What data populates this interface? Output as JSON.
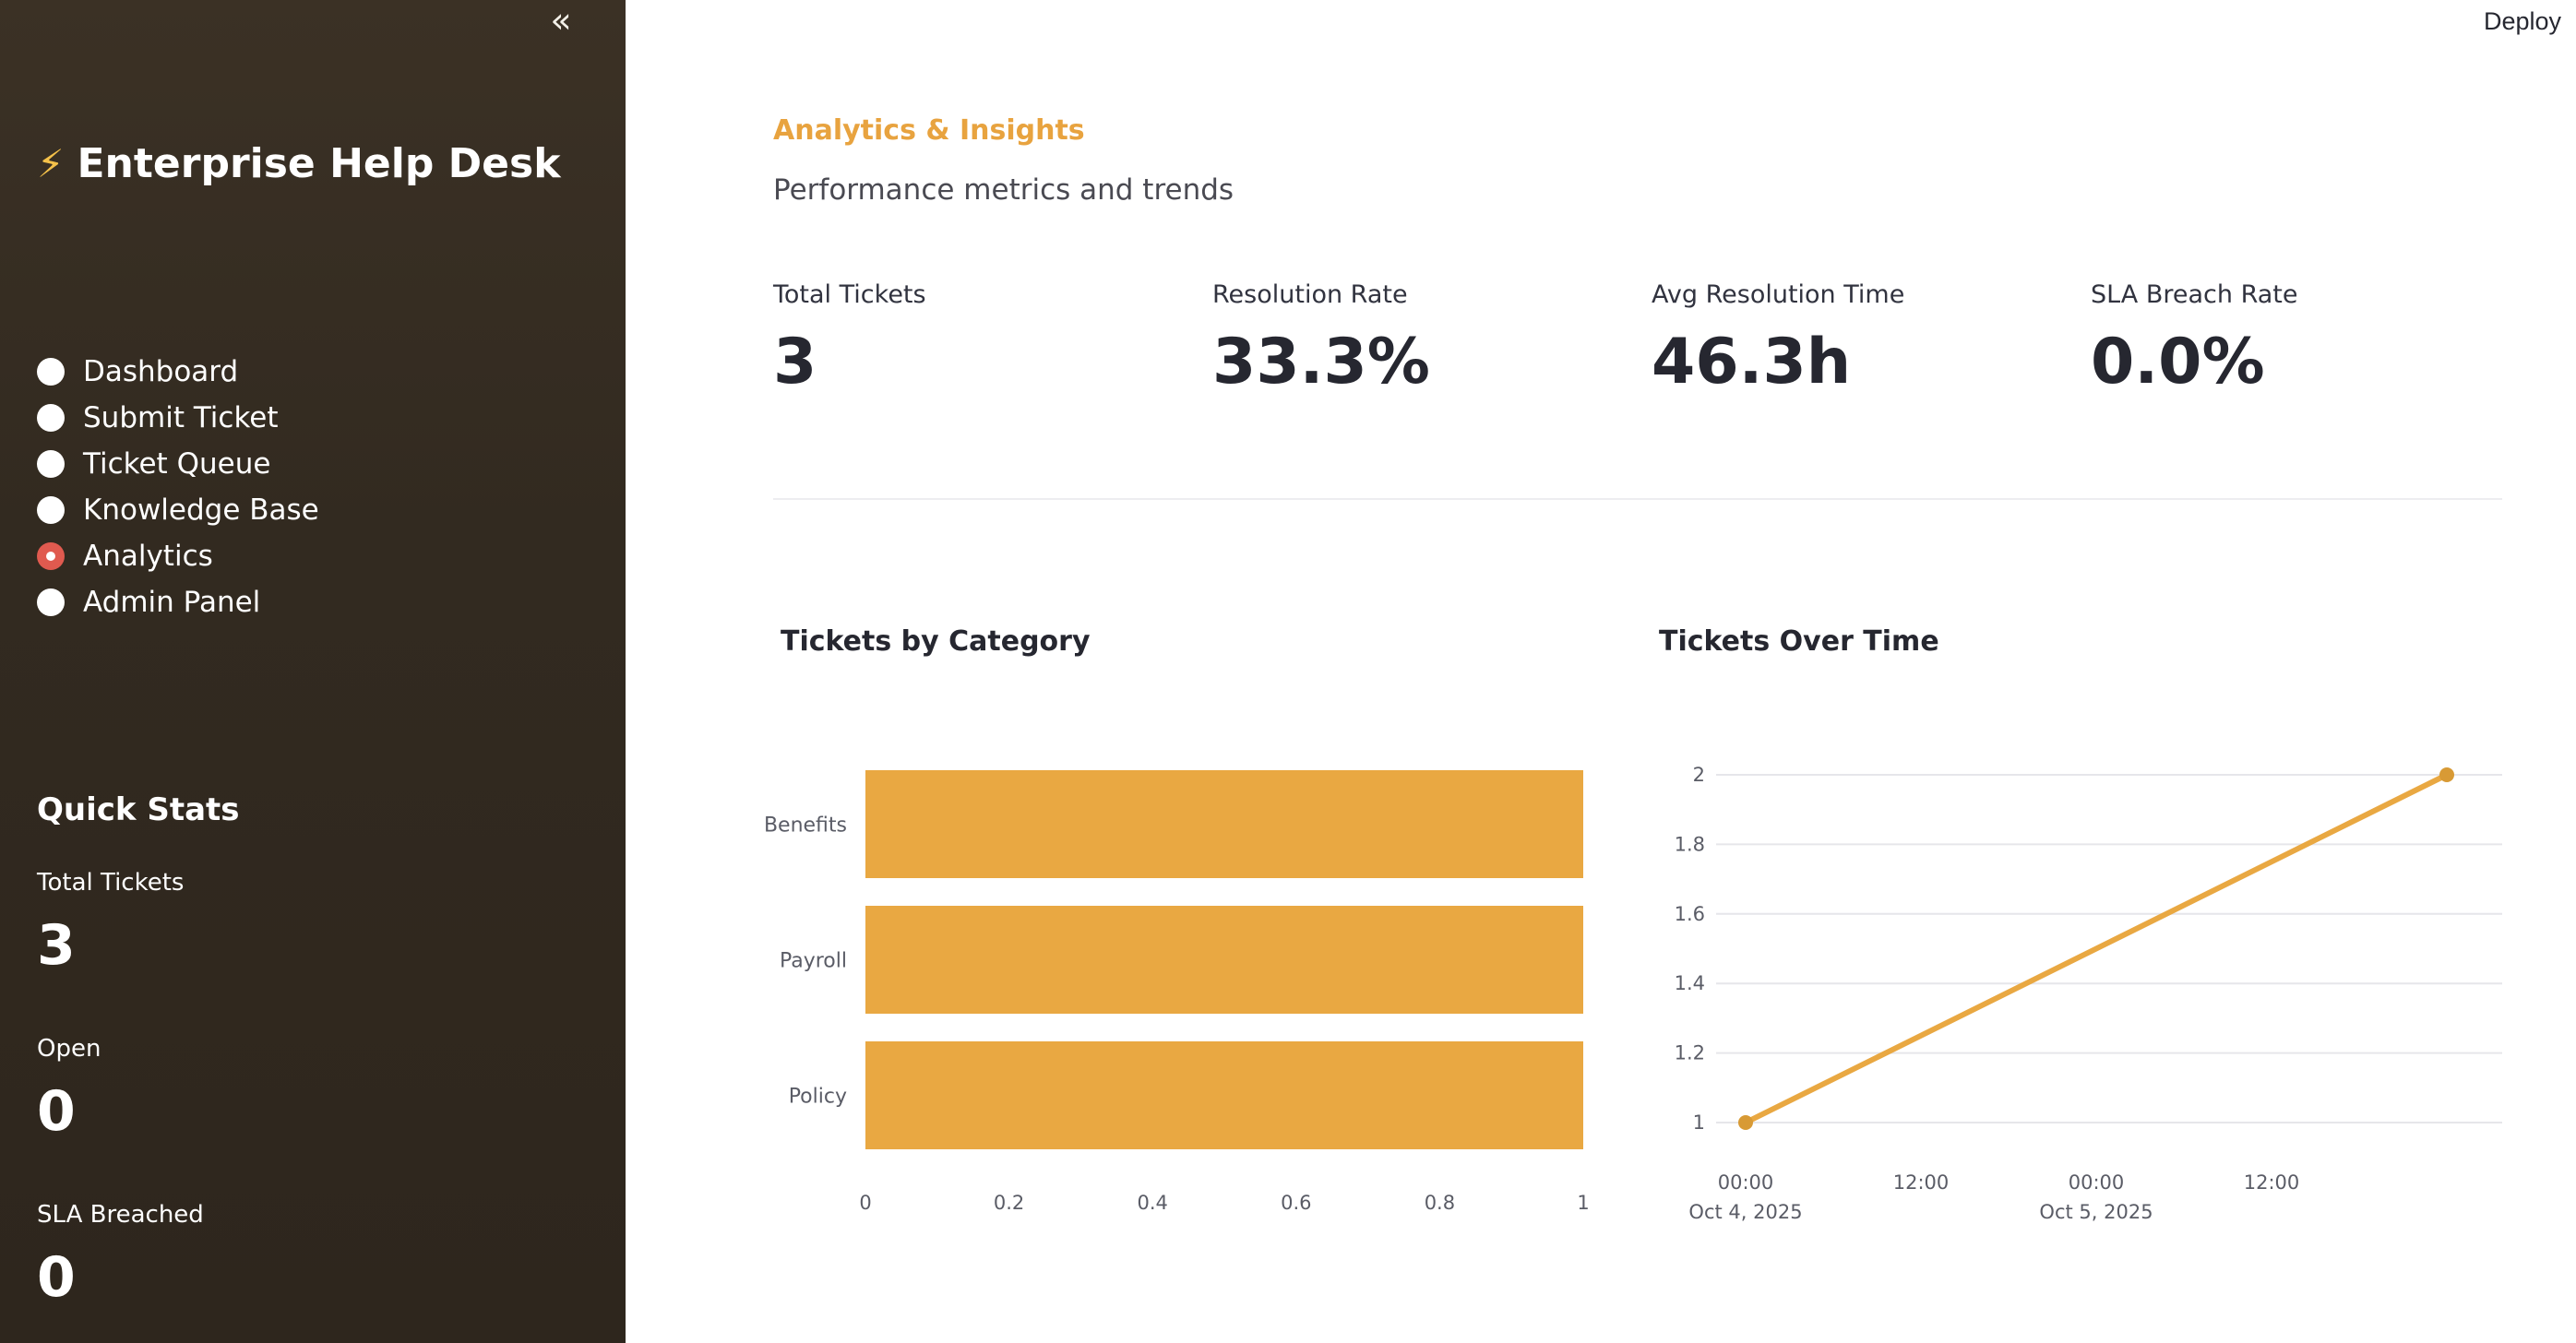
{
  "sidebar": {
    "collapse_icon": "double-chevron-left-icon",
    "collapse_glyph": "«",
    "app_icon": "lightning-bolt-icon",
    "app_icon_glyph": "⚡",
    "app_title": "Enterprise Help Desk",
    "nav": [
      {
        "label": "Dashboard",
        "selected": false
      },
      {
        "label": "Submit Ticket",
        "selected": false
      },
      {
        "label": "Ticket Queue",
        "selected": false
      },
      {
        "label": "Knowledge Base",
        "selected": false
      },
      {
        "label": "Analytics",
        "selected": true
      },
      {
        "label": "Admin Panel",
        "selected": false
      }
    ],
    "quick_stats": {
      "title": "Quick Stats",
      "items": [
        {
          "label": "Total Tickets",
          "value": "3"
        },
        {
          "label": "Open",
          "value": "0"
        },
        {
          "label": "SLA Breached",
          "value": "0"
        }
      ]
    }
  },
  "header": {
    "deploy_label": "Deploy"
  },
  "main": {
    "title": "Analytics & Insights",
    "subtitle": "Performance metrics and trends",
    "metrics": [
      {
        "label": "Total Tickets",
        "value": "3"
      },
      {
        "label": "Resolution Rate",
        "value": "33.3%"
      },
      {
        "label": "Avg Resolution Time",
        "value": "46.3h"
      },
      {
        "label": "SLA Breach Rate",
        "value": "0.0%"
      }
    ]
  },
  "colors": {
    "sidebar_bg": "#3b3125",
    "accent": "#e8a33f",
    "selected_radio": "#e05a4f",
    "bar": "#e9a842",
    "line": "#e9a842"
  },
  "chart_data": [
    {
      "type": "bar",
      "orientation": "horizontal",
      "title": "Tickets by Category",
      "categories": [
        "Benefits",
        "Payroll",
        "Policy"
      ],
      "values": [
        1,
        1,
        1
      ],
      "xlim": [
        0,
        1
      ],
      "x_ticks": [
        "0",
        "0.2",
        "0.4",
        "0.6",
        "0.8",
        "1"
      ],
      "grid": false
    },
    {
      "type": "line",
      "title": "Tickets Over Time",
      "x": [
        "2025-10-04T00:00",
        "2025-10-06T00:00"
      ],
      "y": [
        1,
        2
      ],
      "ylim": [
        1,
        2
      ],
      "y_ticks": [
        "1",
        "1.2",
        "1.4",
        "1.6",
        "1.8",
        "2"
      ],
      "x_ticks": [
        {
          "time": "00:00",
          "date": "Oct 4, 2025"
        },
        {
          "time": "12:00",
          "date": ""
        },
        {
          "time": "00:00",
          "date": "Oct 5, 2025"
        },
        {
          "time": "12:00",
          "date": ""
        }
      ],
      "grid": true
    }
  ]
}
